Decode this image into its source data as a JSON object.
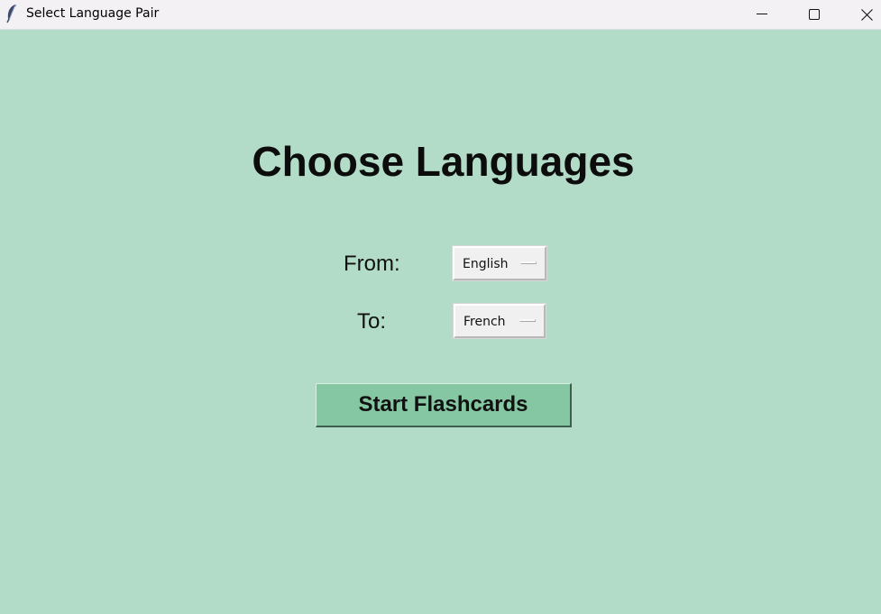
{
  "window": {
    "title": "Select Language Pair",
    "app_icon": "feather-icon",
    "controls": [
      "minimize-icon",
      "maximize-icon",
      "close-icon"
    ]
  },
  "main": {
    "heading": "Choose Languages",
    "from_label": "From:",
    "from_value": "English",
    "to_label": "To:",
    "to_value": "French",
    "start_button": "Start Flashcards"
  },
  "colors": {
    "background": "#b2dcc7",
    "button": "#85c7a3",
    "titlebar": "#f4f1f5"
  }
}
